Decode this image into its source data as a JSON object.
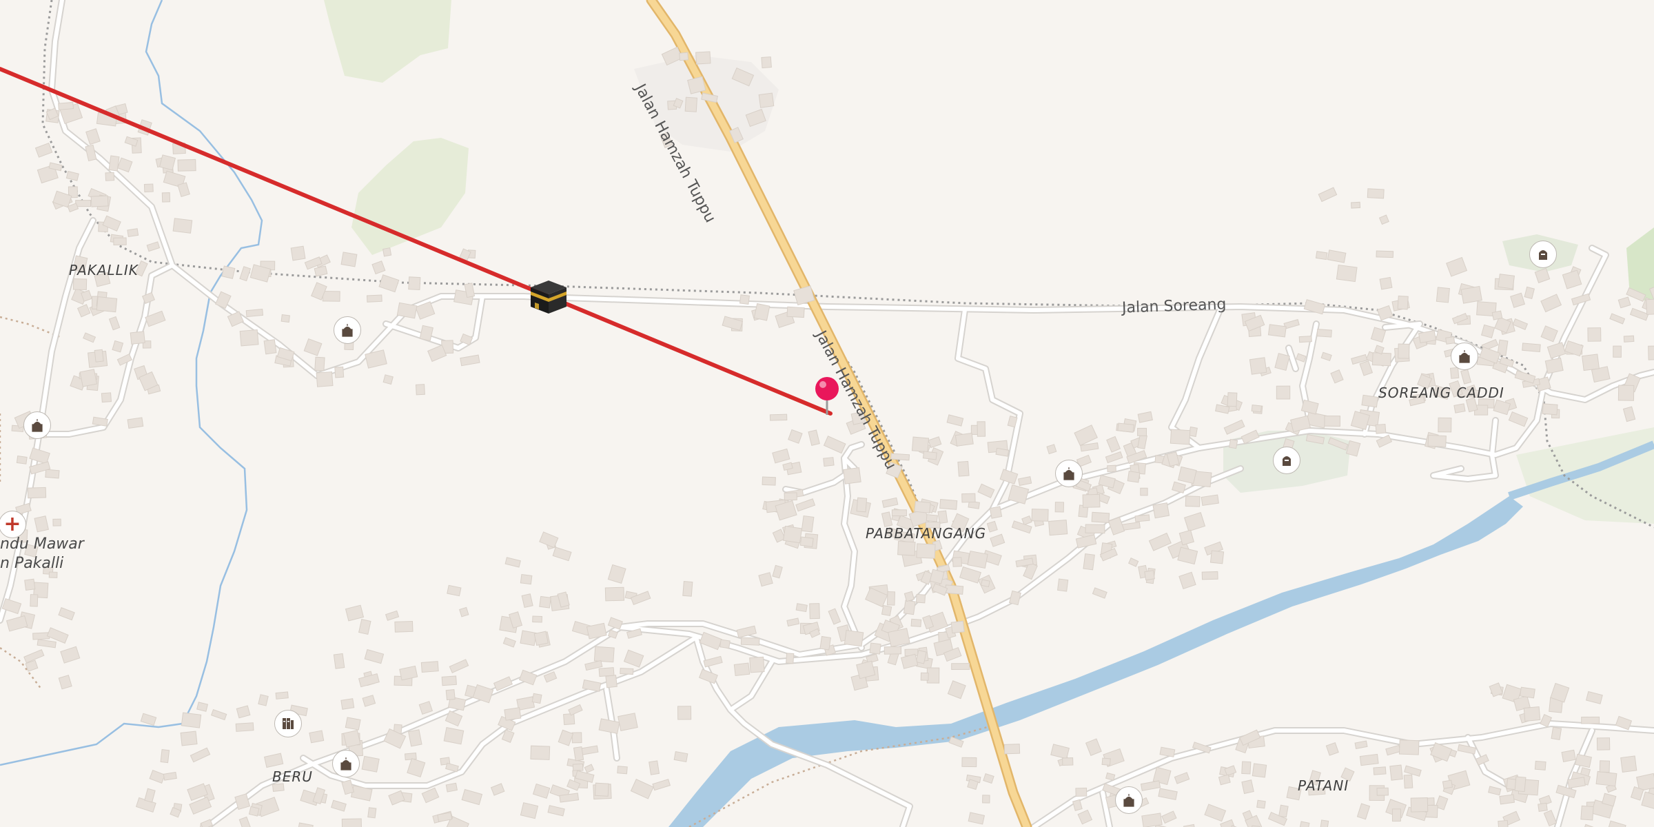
{
  "map": {
    "roads": {
      "main": "Jalan Hamzah Tuppu",
      "secondary": "Jalan Soreang"
    },
    "places": {
      "pakallik": "PAKALLIK",
      "soreang_caddi": "SOREANG CADDI",
      "pabbatangang": "PABBATANGANG",
      "beru": "BERU",
      "patani": "PATANI"
    },
    "poi_labels": {
      "hospital_line1": "ndu Mawar",
      "hospital_line2": "n Pakalli"
    },
    "icons": {
      "mosque": "mosque-icon",
      "hospital": "hospital-icon",
      "cemetery": "cemetery-icon",
      "school": "school-icon",
      "qibla": "kaaba-icon",
      "location": "location-pin-icon"
    },
    "colors": {
      "background": "#f7f4f0",
      "main_road": "#f6cf86",
      "water": "#a9cbe3",
      "park": "#dfe8d0",
      "qibla_line": "#d62b2b",
      "pin": "#e9175b"
    }
  }
}
